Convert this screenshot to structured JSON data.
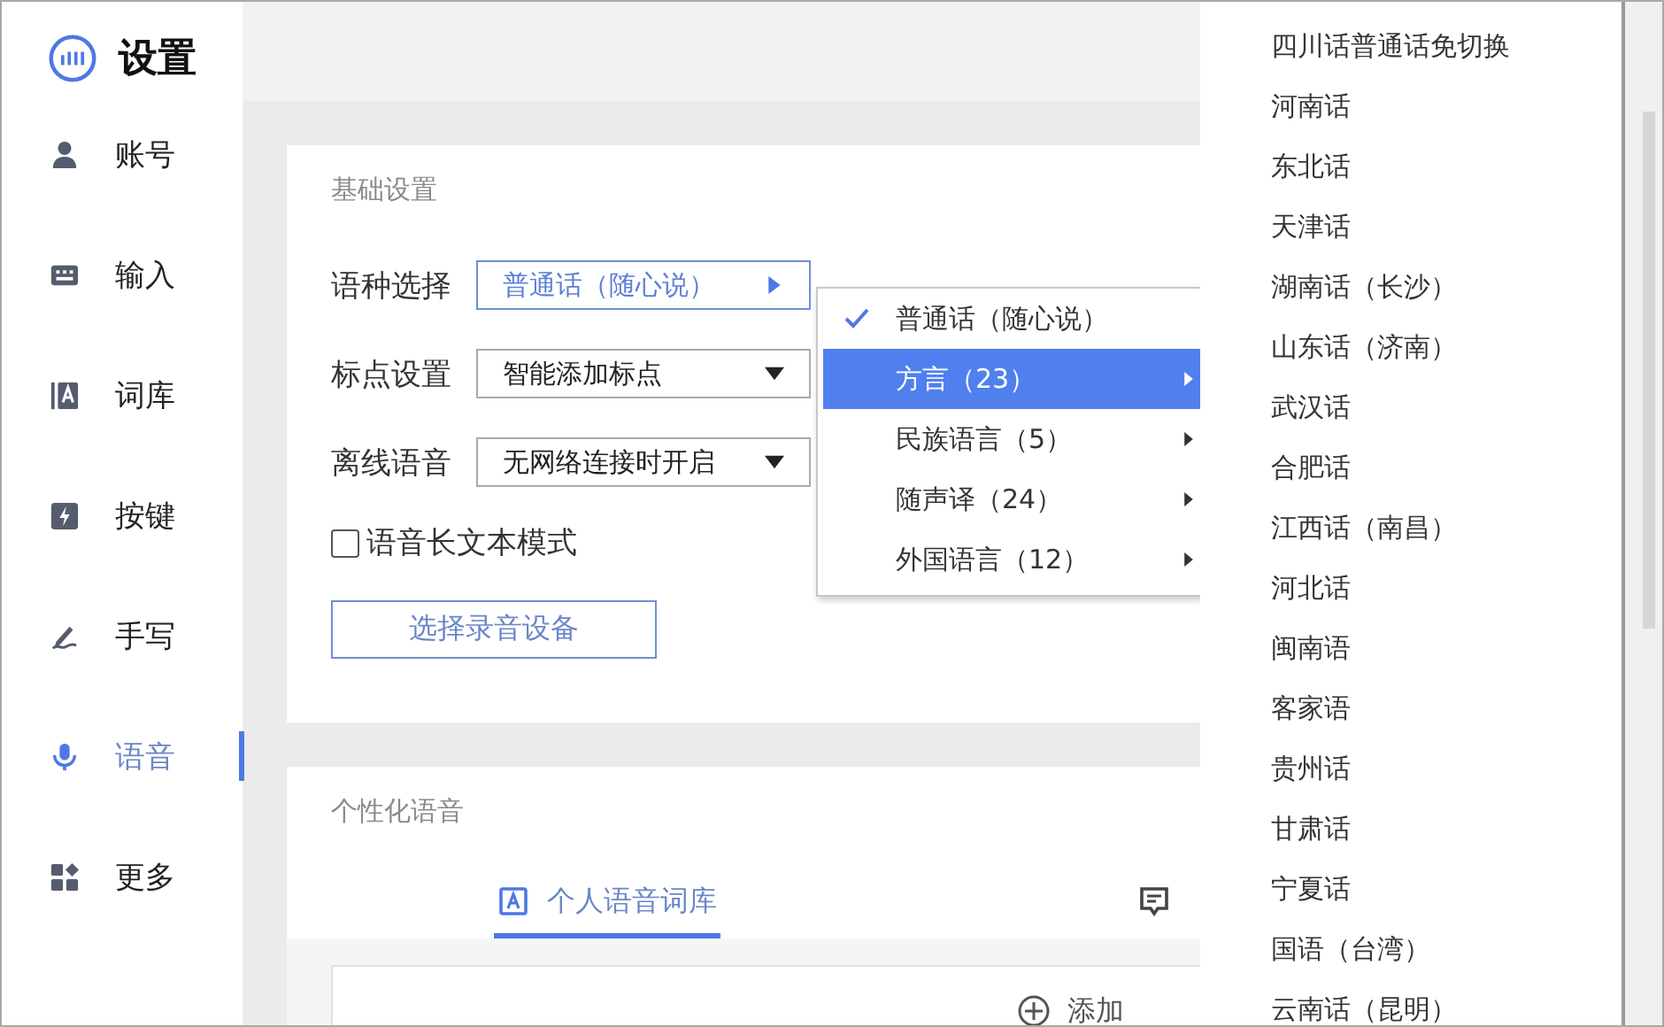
{
  "app": {
    "title": "设置"
  },
  "sidebar": {
    "items": [
      {
        "label": "账号",
        "kind": "account",
        "selected": false
      },
      {
        "label": "输入",
        "kind": "keyboard",
        "selected": false
      },
      {
        "label": "词库",
        "kind": "lexicon",
        "selected": false
      },
      {
        "label": "按键",
        "kind": "keys",
        "selected": false
      },
      {
        "label": "手写",
        "kind": "handwriting",
        "selected": false
      },
      {
        "label": "语音",
        "kind": "voice",
        "selected": true
      },
      {
        "label": "更多",
        "kind": "more",
        "selected": false
      }
    ]
  },
  "basic_settings": {
    "title": "基础设置",
    "rows": [
      {
        "label": "语种选择",
        "value": "普通话（随心说）",
        "kind": "submenu",
        "open": true
      },
      {
        "label": "标点设置",
        "value": "智能添加标点",
        "kind": "dropdown",
        "open": false
      },
      {
        "label": "离线语音",
        "value": "无网络连接时开启",
        "kind": "dropdown",
        "open": false
      }
    ],
    "long_text_mode": {
      "label": "语音长文本模式",
      "checked": false
    },
    "device_button": "选择录音设备"
  },
  "language_menu": {
    "items": [
      {
        "label": "普通话（随心说）",
        "checked": true,
        "selected": false,
        "submenu": false
      },
      {
        "label": "方言（23）",
        "checked": false,
        "selected": true,
        "submenu": true
      },
      {
        "label": "民族语言（5）",
        "checked": false,
        "selected": false,
        "submenu": true
      },
      {
        "label": "随声译（24）",
        "checked": false,
        "selected": false,
        "submenu": true
      },
      {
        "label": "外国语言（12）",
        "checked": false,
        "selected": false,
        "submenu": true
      }
    ]
  },
  "dialect_menu": {
    "items": [
      "四川话普通话免切换",
      "河南话",
      "东北话",
      "天津话",
      "湖南话（长沙）",
      "山东话（济南）",
      "武汉话",
      "合肥话",
      "江西话（南昌）",
      "河北话",
      "闽南语",
      "客家语",
      "贵州话",
      "甘肃话",
      "宁夏话",
      "国语（台湾）",
      "云南话（昆明）"
    ]
  },
  "personal_voice": {
    "title": "个性化语音",
    "tabs": [
      {
        "label": "个人语音词库",
        "kind": "lexicon",
        "selected": true
      },
      {
        "kind": "note",
        "selected": false
      }
    ],
    "add_button": "添加"
  }
}
